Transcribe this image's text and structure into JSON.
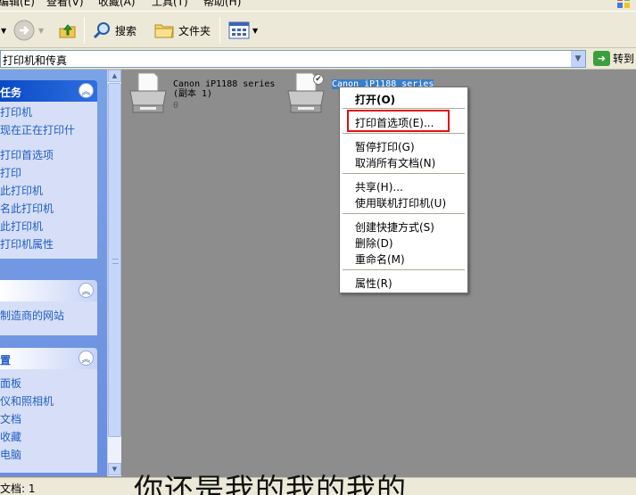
{
  "menubar": {
    "items": [
      "编辑(E)",
      "查看(V)",
      "收藏(A)",
      "工具(T)",
      "帮助(H)"
    ]
  },
  "toolbar": {
    "search_label": "搜索",
    "folders_label": "文件夹"
  },
  "address": {
    "value": "打印机和传真",
    "go_label": "转到"
  },
  "task_pane": {
    "panels": [
      {
        "title": "任务",
        "items": [
          "打印机",
          "现在正在打印什",
          "打印首选项",
          "打印",
          "此打印机",
          "名此打印机",
          "此打印机",
          "打印机属性"
        ]
      },
      {
        "title": "",
        "items": [
          "制造商的网站"
        ]
      },
      {
        "title": "置",
        "items": [
          "面板",
          "仪和照相机",
          "文档",
          "收藏",
          "电脑"
        ]
      }
    ]
  },
  "printers": [
    {
      "name": "Canon iP1188 series",
      "copy": "(副本 1)",
      "docs": "0"
    },
    {
      "name": "Canon iP1188 series",
      "copy": "",
      "docs": "",
      "selected": true
    }
  ],
  "context_menu": {
    "items": [
      {
        "label": "打开(O)",
        "bold": true
      },
      {
        "label": "打印首选项(E)...",
        "highlighted": true
      },
      {
        "label": "暂停打印(G)"
      },
      {
        "label": "取消所有文档(N)"
      },
      {
        "label": "共享(H)..."
      },
      {
        "label": "使用联机打印机(U)"
      },
      {
        "label": "创建快捷方式(S)"
      },
      {
        "label": "删除(D)"
      },
      {
        "label": "重命名(M)"
      },
      {
        "label": "属性(R)"
      }
    ]
  },
  "subtitle": "你还是我的我的我的",
  "statusbar": {
    "text": "文档: 1"
  },
  "colors": {
    "highlight_box": "#e01010",
    "selection": "#3a7ec9",
    "task_link": "#215dc6",
    "panel_header": "#0a49c6"
  }
}
